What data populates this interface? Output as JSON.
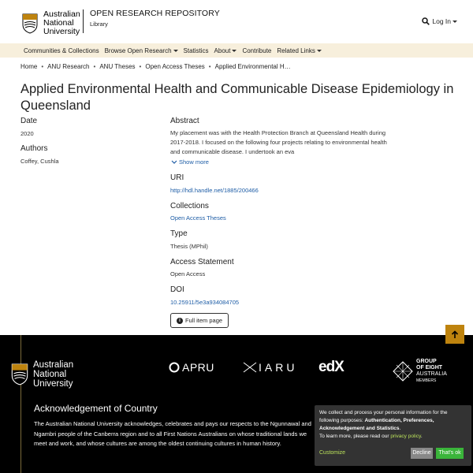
{
  "header": {
    "logo_lines": [
      "Australian",
      "National",
      "University"
    ],
    "repo_title": "OPEN RESEARCH REPOSITORY",
    "repo_subtitle": "Library",
    "login_label": "Log In"
  },
  "nav": {
    "items": [
      {
        "label": "Communities & Collections",
        "dropdown": false
      },
      {
        "label": "Browse Open Research",
        "dropdown": true
      },
      {
        "label": "Statistics",
        "dropdown": false
      },
      {
        "label": "About",
        "dropdown": true
      },
      {
        "label": "Contribute",
        "dropdown": false
      },
      {
        "label": "Related Links",
        "dropdown": true
      }
    ]
  },
  "breadcrumb": [
    "Home",
    "ANU Research",
    "ANU Theses",
    "Open Access Theses",
    "Applied Environmental H…"
  ],
  "item": {
    "title": "Applied Environmental Health and Communicable Disease Epidemiology in Queensland",
    "date_label": "Date",
    "date_value": "2020",
    "authors_label": "Authors",
    "authors_value": "Coffey, Cushla",
    "abstract_label": "Abstract",
    "abstract_value": "My placement was with the Health Protection Branch at Queensland Health during 2017-2018. I focused on the following four projects relating to environmental health and communicable disease. I undertook an eva",
    "show_more": "Show more",
    "uri_label": "URI",
    "uri_value": "http://hdl.handle.net/1885/200466",
    "collections_label": "Collections",
    "collections_value": "Open Access Theses",
    "type_label": "Type",
    "type_value": "Thesis (MPhil)",
    "access_label": "Access Statement",
    "access_value": "Open Access",
    "doi_label": "DOI",
    "doi_value": "10.25911/5e3a934084705",
    "full_item_label": "Full item page"
  },
  "footer": {
    "logo_lines": [
      "Australian",
      "National",
      "University"
    ],
    "partners": [
      "APRU",
      "IARU",
      "edX"
    ],
    "go8_lines": [
      "GROUP",
      "OF EIGHT",
      "AUSTRALIA"
    ],
    "go8_small": "MEMBERS",
    "ack_title": "Acknowledgement of Country",
    "ack_text": "The Australian National University acknowledges, celebrates and pays our respects to the Ngunnawal and Ngambri people of the Canberra region and to all First Nations Australians on whose traditional lands we meet and work, and whose cultures are among the oldest continuing cultures in human history."
  },
  "cookie": {
    "text_before": "We collect and process your personal information for the following purposes: ",
    "purposes": "Authentication, Preferences, Acknowledgement and Statistics",
    "text_after": ".",
    "learn_more": "To learn more, please read our ",
    "policy_link": "privacy policy",
    "customize": "Customize",
    "decline": "Decline",
    "accept": "That's ok"
  },
  "colors": {
    "nav_bg": "#f7efdc",
    "link": "#1e5da6",
    "gold": "#be830e",
    "accept_green": "#3ab53a"
  }
}
